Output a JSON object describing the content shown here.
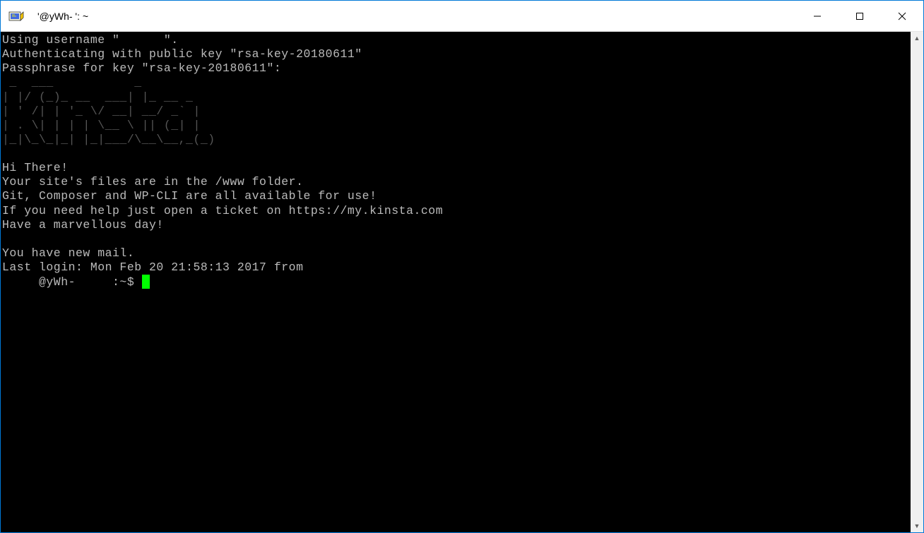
{
  "titlebar": {
    "title": "     '@yWh-       ': ~"
  },
  "terminal": {
    "line_username": "Using username \"      \".",
    "line_auth": "Authenticating with public key \"rsa-key-20180611\"",
    "line_passphrase": "Passphrase for key \"rsa-key-20180611\":",
    "ascii_art": " _  ___           _\n| |/ (_)_ __  ___| |_ __ _\n| ' /| | '_ \\/ __| __/ _` |\n| . \\| | | | \\__ \\ || (_| |\n|_|\\_\\_|_| |_|___/\\__\\__,_(_)",
    "line_greeting": "Hi There!",
    "line_files": "Your site's files are in the /www folder.",
    "line_tools": "Git, Composer and WP-CLI are all available for use!",
    "line_help": "If you need help just open a ticket on https://my.kinsta.com",
    "line_day": "Have a marvellous day!",
    "line_mail": "You have new mail.",
    "line_last_login": "Last login: Mon Feb 20 21:58:13 2017 from ",
    "prompt": "     @yWh-     :~$ "
  }
}
